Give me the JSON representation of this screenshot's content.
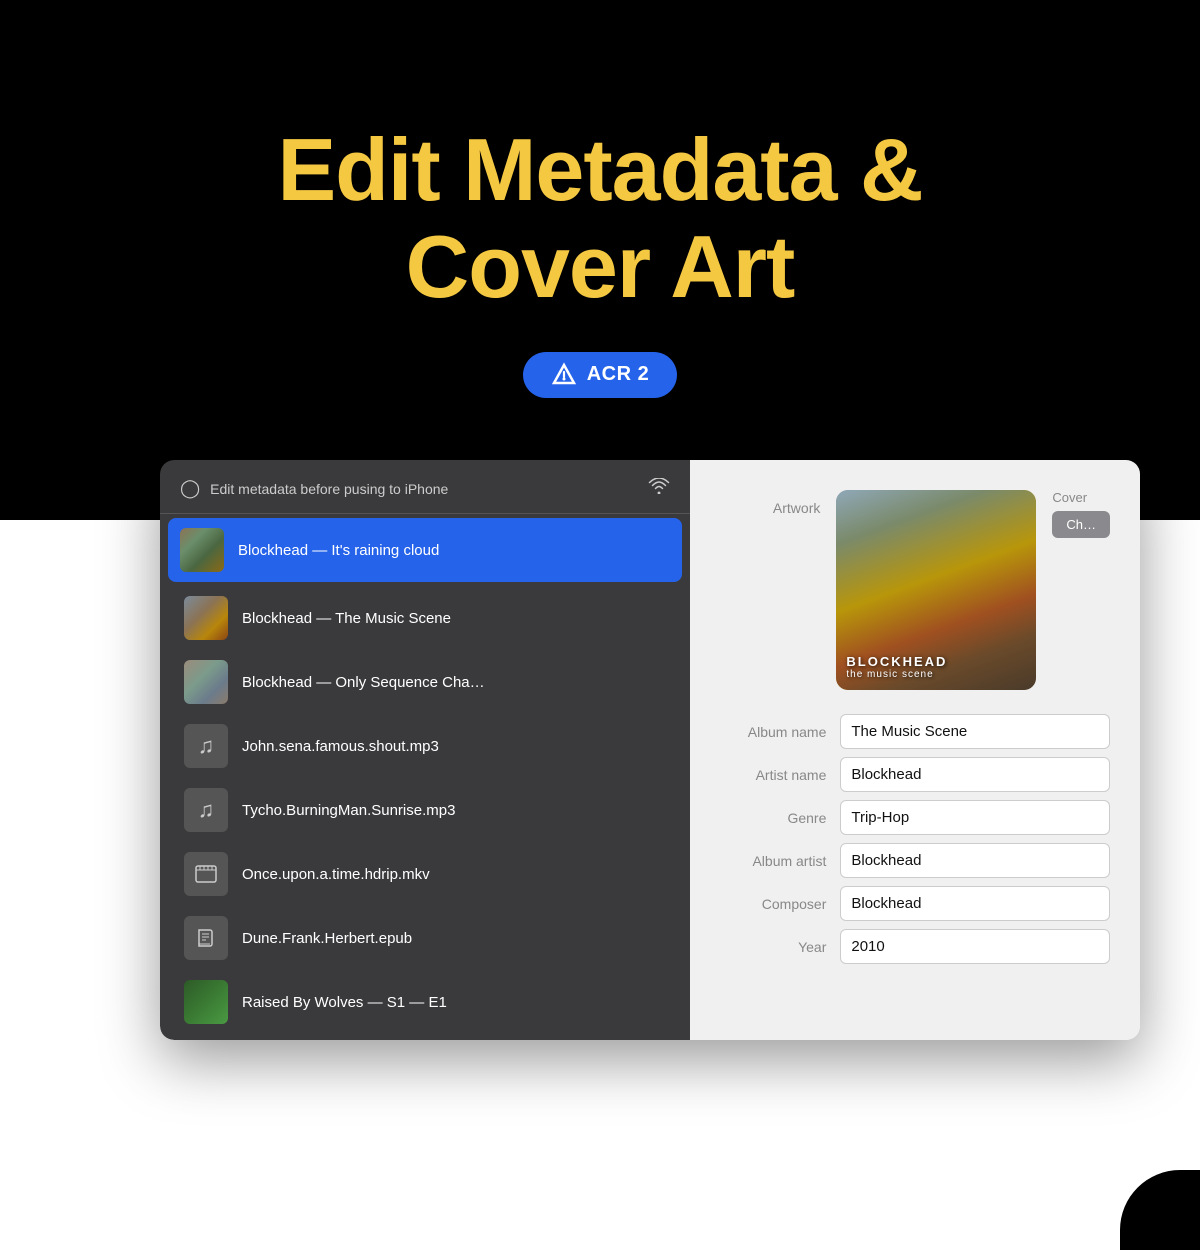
{
  "hero": {
    "title_line1": "Edit Metadata &",
    "title_line2": "Cover Art",
    "badge_label": "ACR 2"
  },
  "left_panel": {
    "header_text": "Edit metadata before pusing to iPhone",
    "tracks": [
      {
        "id": 1,
        "name": "Blockhead — It's raining cloud",
        "type": "album_art",
        "art": "rain",
        "active": true
      },
      {
        "id": 2,
        "name": "Blockhead — The Music Scene",
        "type": "album_art",
        "art": "music",
        "active": false
      },
      {
        "id": 3,
        "name": "Blockhead — Only Sequence Cha…",
        "type": "album_art",
        "art": "seq",
        "active": false
      },
      {
        "id": 4,
        "name": "John.sena.famous.shout.mp3",
        "type": "music",
        "active": false
      },
      {
        "id": 5,
        "name": "Tycho.BurningMan.Sunrise.mp3",
        "type": "music",
        "active": false
      },
      {
        "id": 6,
        "name": "Once.upon.a.time.hdrip.mkv",
        "type": "video",
        "active": false
      },
      {
        "id": 7,
        "name": "Dune.Frank.Herbert.epub",
        "type": "book",
        "active": false
      },
      {
        "id": 8,
        "name": "Raised By Wolves — S1 — E1",
        "type": "album_art",
        "art": "wolves",
        "active": false
      }
    ]
  },
  "right_panel": {
    "artwork_label": "Artwork",
    "cover_label": "Cover",
    "cover_btn_label": "Ch…",
    "fields": [
      {
        "label": "Album name",
        "value": "The Music Scene"
      },
      {
        "label": "Artist name",
        "value": "Blockhead"
      },
      {
        "label": "Genre",
        "value": "Trip-Hop"
      },
      {
        "label": "Album artist",
        "value": "Blockhead"
      },
      {
        "label": "Composer",
        "value": "Blockhead"
      },
      {
        "label": "Year",
        "value": "2010"
      }
    ],
    "artwork_text": "BLOCKHEAD\nthe music scene"
  }
}
